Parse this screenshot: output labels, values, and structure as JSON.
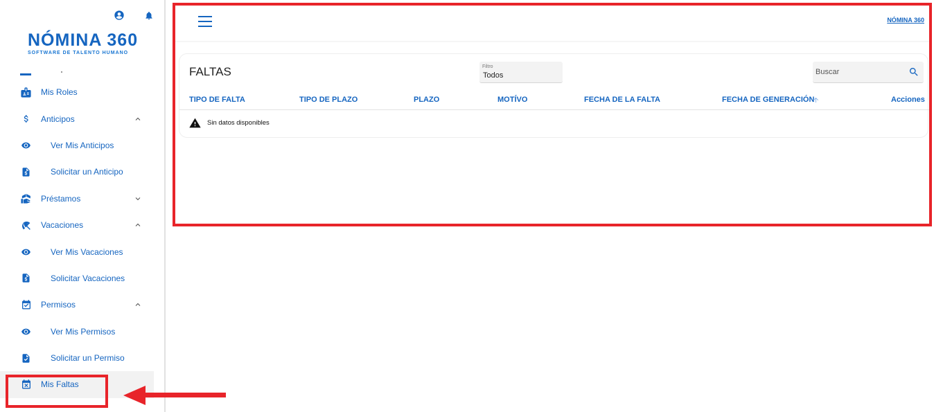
{
  "sidebar": {
    "logo": {
      "main": "NÓMINA 360",
      "sub": "SOFTWARE DE TALENTO HUMANO"
    },
    "items": [
      {
        "label": "Mis Roles",
        "icon": "id-badge-icon",
        "level": 0
      },
      {
        "label": "Anticipos",
        "icon": "dollar-icon",
        "level": 0,
        "expanded": true
      },
      {
        "label": "Ver Mis Anticipos",
        "icon": "eye-icon",
        "level": 1
      },
      {
        "label": "Solicitar un Anticipo",
        "icon": "money-doc-icon",
        "level": 1
      },
      {
        "label": "Préstamos",
        "icon": "hand-money-icon",
        "level": 0,
        "expanded": false
      },
      {
        "label": "Vacaciones",
        "icon": "beach-umbrella-icon",
        "level": 0,
        "expanded": true
      },
      {
        "label": "Ver Mis Vacaciones",
        "icon": "eye-icon",
        "level": 1
      },
      {
        "label": "Solicitar Vacaciones",
        "icon": "money-doc-icon",
        "level": 1
      },
      {
        "label": "Permisos",
        "icon": "calendar-check-icon",
        "level": 0,
        "expanded": true
      },
      {
        "label": "Ver Mis Permisos",
        "icon": "eye-icon",
        "level": 1
      },
      {
        "label": "Solicitar un Permiso",
        "icon": "doc-check-icon",
        "level": 1
      },
      {
        "label": "Mis Faltas",
        "icon": "calendar-x-icon",
        "level": 0,
        "active": true
      }
    ]
  },
  "header": {
    "mini_logo": "NÓMINA 360"
  },
  "card": {
    "title": "FALTAS",
    "filter": {
      "label": "Filtro",
      "value": "Todos"
    },
    "search": {
      "placeholder": "Buscar"
    },
    "columns": [
      "TIPO DE FALTA",
      "TIPO DE PLAZO",
      "PLAZO",
      "MOTÍVO",
      "FECHA DE LA FALTA",
      "FECHA DE GENERACIÓN",
      "Acciones"
    ],
    "empty_message": "Sin datos disponibles"
  },
  "colors": {
    "brand": "#1565c0",
    "annotation": "#e8242a"
  }
}
